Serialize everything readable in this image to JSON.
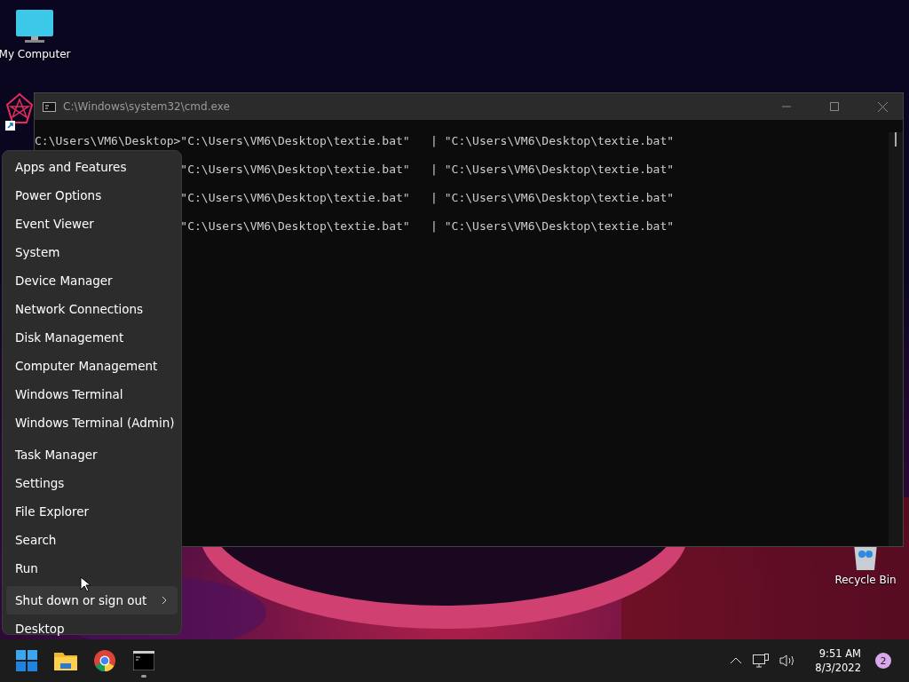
{
  "desktop_icons": [
    {
      "kind": "computer",
      "label": "My Computer"
    },
    {
      "kind": "shortcut"
    },
    {
      "kind": "recycle",
      "label": "Recycle Bin"
    }
  ],
  "console_window": {
    "title": "C:\\Windows\\system32\\cmd.exe",
    "lines": [
      {
        "prompt": "C:\\Users\\VM6\\Desktop>",
        "command": "\"C:\\Users\\VM6\\Desktop\\textie.bat\"   | \"C:\\Users\\VM6\\Desktop\\textie.bat\""
      },
      {
        "command": "\"C:\\Users\\VM6\\Desktop\\textie.bat\"   | \"C:\\Users\\VM6\\Desktop\\textie.bat\""
      },
      {
        "command": "\"C:\\Users\\VM6\\Desktop\\textie.bat\"   | \"C:\\Users\\VM6\\Desktop\\textie.bat\""
      },
      {
        "command": "\"C:\\Users\\VM6\\Desktop\\textie.bat\"   | \"C:\\Users\\VM6\\Desktop\\textie.bat\""
      }
    ]
  },
  "context_menu": {
    "groups": [
      [
        {
          "label": "Apps and Features",
          "selected": false
        },
        {
          "label": "Power Options",
          "selected": false
        },
        {
          "label": "Event Viewer",
          "selected": false
        },
        {
          "label": "System",
          "selected": false
        },
        {
          "label": "Device Manager",
          "selected": false
        },
        {
          "label": "Network Connections",
          "selected": false
        },
        {
          "label": "Disk Management",
          "selected": false
        },
        {
          "label": "Computer Management",
          "selected": false
        },
        {
          "label": "Windows Terminal",
          "selected": false
        },
        {
          "label": "Windows Terminal (Admin)",
          "selected": false
        }
      ],
      [
        {
          "label": "Task Manager",
          "selected": false
        },
        {
          "label": "Settings",
          "selected": false
        },
        {
          "label": "File Explorer",
          "selected": false
        },
        {
          "label": "Search",
          "selected": false
        },
        {
          "label": "Run",
          "selected": false
        }
      ],
      [
        {
          "label": "Shut down or sign out",
          "selected": true,
          "submenu": true
        },
        {
          "label": "Desktop",
          "selected": false
        }
      ]
    ]
  },
  "taskbar": {
    "apps": [
      {
        "kind": "start",
        "running": false
      },
      {
        "kind": "folder",
        "running": false
      },
      {
        "kind": "browser",
        "running": false
      },
      {
        "kind": "console",
        "running": true
      }
    ],
    "clock": {
      "time": "9:51 AM",
      "date": "8/3/2022"
    },
    "notifications": "2"
  }
}
